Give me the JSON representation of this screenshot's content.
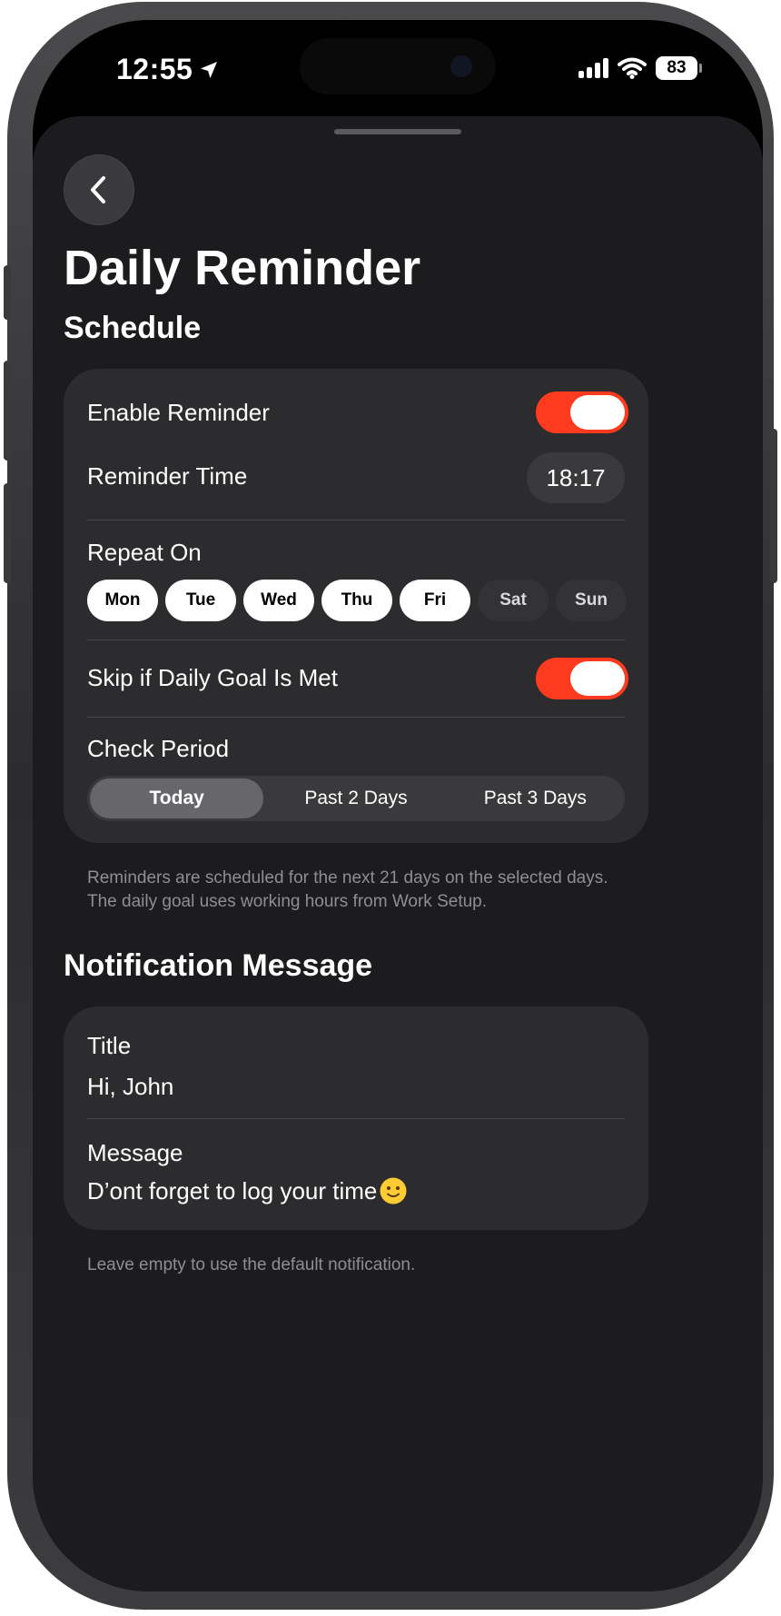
{
  "status_bar": {
    "time": "12:55",
    "battery": "83"
  },
  "header": {
    "title": "Daily Reminder"
  },
  "schedule": {
    "section_title": "Schedule",
    "enable_reminder_label": "Enable Reminder",
    "enable_reminder_on": true,
    "reminder_time_label": "Reminder Time",
    "reminder_time_value": "18:17",
    "repeat_on_label": "Repeat On",
    "days": [
      {
        "label": "Mon",
        "selected": true
      },
      {
        "label": "Tue",
        "selected": true
      },
      {
        "label": "Wed",
        "selected": true
      },
      {
        "label": "Thu",
        "selected": true
      },
      {
        "label": "Fri",
        "selected": true
      },
      {
        "label": "Sat",
        "selected": false
      },
      {
        "label": "Sun",
        "selected": false
      }
    ],
    "skip_label": "Skip if Daily Goal Is Met",
    "skip_on": true,
    "check_period_label": "Check Period",
    "check_period_options": [
      "Today",
      "Past 2 Days",
      "Past 3 Days"
    ],
    "check_period_selected": "Today",
    "footnote": "Reminders are scheduled for the next 21 days on the selected days. The daily goal uses working hours from Work Setup."
  },
  "notification": {
    "section_title": "Notification Message",
    "title_label": "Title",
    "title_value": "Hi, John",
    "message_label": "Message",
    "message_value": "D’ont forget to log your time",
    "footnote": "Leave empty to use the default notification."
  },
  "colors": {
    "accent": "#ff3b1f",
    "background": "#1c1c1e",
    "card": "#2c2c2e"
  },
  "icons": {
    "back": "chevron-left-icon",
    "location": "location-arrow-icon",
    "signal": "cellular-signal-icon",
    "wifi": "wifi-icon",
    "emoji": "slightly-smiling-face-icon"
  }
}
